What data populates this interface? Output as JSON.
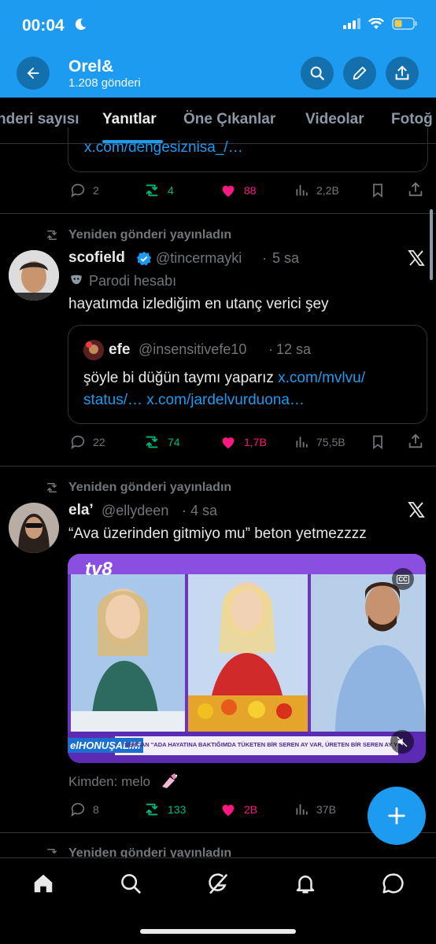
{
  "status_bar": {
    "time": "00:04"
  },
  "header": {
    "title": "Orel&",
    "subtitle": "1.208 gönderi"
  },
  "tabs": [
    {
      "label": "nderi sayısı"
    },
    {
      "label": "Yanıtlar",
      "active": true
    },
    {
      "label": "Öne Çıkanlar"
    },
    {
      "label": "Videolar"
    },
    {
      "label": "Fotoğ"
    }
  ],
  "colors": {
    "accent": "#1d9bf0",
    "like": "#f91880",
    "repost": "#00ba7c",
    "background": "#000000"
  },
  "post0": {
    "link": "x.com/dengesiznisa_/…",
    "replies": "2",
    "reposts": "4",
    "likes": "88",
    "views": "2,2B"
  },
  "post1": {
    "repost_label": "Yeniden gönderi yayınladın",
    "name": "scofield",
    "handle": "@tincermayki",
    "time": "5 sa",
    "badge": "Parodi hesabı",
    "text": "hayatımda izlediğim en utanç verici şey",
    "quote": {
      "name": "efe",
      "handle": "@insensitivefe10",
      "time": "12 sa",
      "text_plain": "şöyle bi düğün taymı yaparız ",
      "link1": "x.com/mvlvu/",
      "link2": "status/…",
      "link3": "x.com/jardelvurduona…"
    },
    "replies": "22",
    "reposts": "74",
    "likes": "1,7B",
    "views": "75,5B"
  },
  "post2": {
    "repost_label": "Yeniden gönderi yayınladın",
    "name": "ela’",
    "handle": "@ellydeen",
    "time": "4 sa",
    "text": "“Ava üzerinden gitmiyo mu” beton yetmezzzz",
    "video": {
      "channel_logo": "tv8",
      "show_logo": "elHONUŞALIM",
      "caption": "SERCAN \"ADA HAYATINA BAKTIĞIMDA TÜKETEN BİR SEREN AY VAR, ÜRETEN BİR SEREN AY YOK\"",
      "cc": "CC"
    },
    "from_label": "Kimden: melo",
    "replies": "8",
    "reposts": "133",
    "likes": "2B",
    "views": "37B"
  },
  "post3": {
    "repost_label": "Yeniden gönderi yayınladın"
  },
  "icons": {
    "back": "arrow-left-icon",
    "search": "search-icon",
    "edit": "pencil-icon",
    "share": "share-icon",
    "fab": "plus-icon",
    "home": "home-icon",
    "explore": "search-icon",
    "grok": "grok-icon",
    "notifications": "bell-icon",
    "messages": "message-icon"
  }
}
